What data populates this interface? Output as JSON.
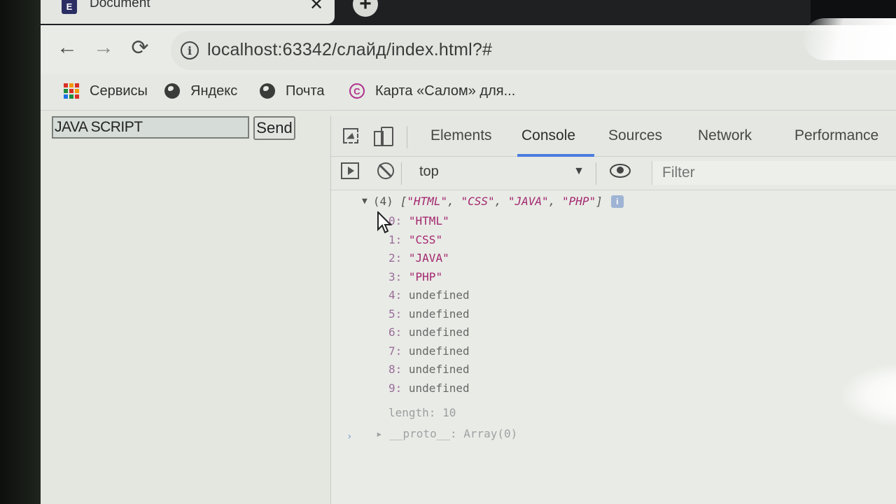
{
  "tab": {
    "title": "Document",
    "favicon_letter": "E",
    "close": "✕",
    "new_tab": "+"
  },
  "toolbar": {
    "back": "←",
    "forward": "→",
    "reload": "⟳",
    "url": "localhost:63342/слайд/index.html?#"
  },
  "bookmarks": [
    {
      "label": "Сервисы",
      "icon": "apps-grid-icon"
    },
    {
      "label": "Яндекс",
      "icon": "globe-icon"
    },
    {
      "label": "Почта",
      "icon": "globe-icon"
    },
    {
      "label": "Карта «Салом» для...",
      "icon": "salom-icon"
    }
  ],
  "page": {
    "input_value": "JAVA SCRIPT",
    "send_label": "Send"
  },
  "devtools": {
    "tabs": [
      "Elements",
      "Console",
      "Sources",
      "Network",
      "Performance"
    ],
    "active_tab": "Console",
    "context": "top",
    "filter_placeholder": "Filter",
    "accent": "#4a7de0"
  },
  "console": {
    "array_count": "(4)",
    "array_preview_open": "[",
    "array_preview_items": [
      "\"HTML\"",
      "\"CSS\"",
      "\"JAVA\"",
      "\"PHP\""
    ],
    "array_preview_close": "]",
    "items": [
      {
        "index": "0:",
        "value": "\"HTML\"",
        "kind": "string"
      },
      {
        "index": "1:",
        "value": "\"CSS\"",
        "kind": "string"
      },
      {
        "index": "2:",
        "value": "\"JAVA\"",
        "kind": "string"
      },
      {
        "index": "3:",
        "value": "\"PHP\"",
        "kind": "string"
      },
      {
        "index": "4:",
        "value": "undefined",
        "kind": "undefined"
      },
      {
        "index": "5:",
        "value": "undefined",
        "kind": "undefined"
      },
      {
        "index": "6:",
        "value": "undefined",
        "kind": "undefined"
      },
      {
        "index": "7:",
        "value": "undefined",
        "kind": "undefined"
      },
      {
        "index": "8:",
        "value": "undefined",
        "kind": "undefined"
      },
      {
        "index": "9:",
        "value": "undefined",
        "kind": "undefined"
      }
    ],
    "length_row": "length: 10",
    "proto_row": "__proto__: Array(0)",
    "prompt": "›"
  }
}
